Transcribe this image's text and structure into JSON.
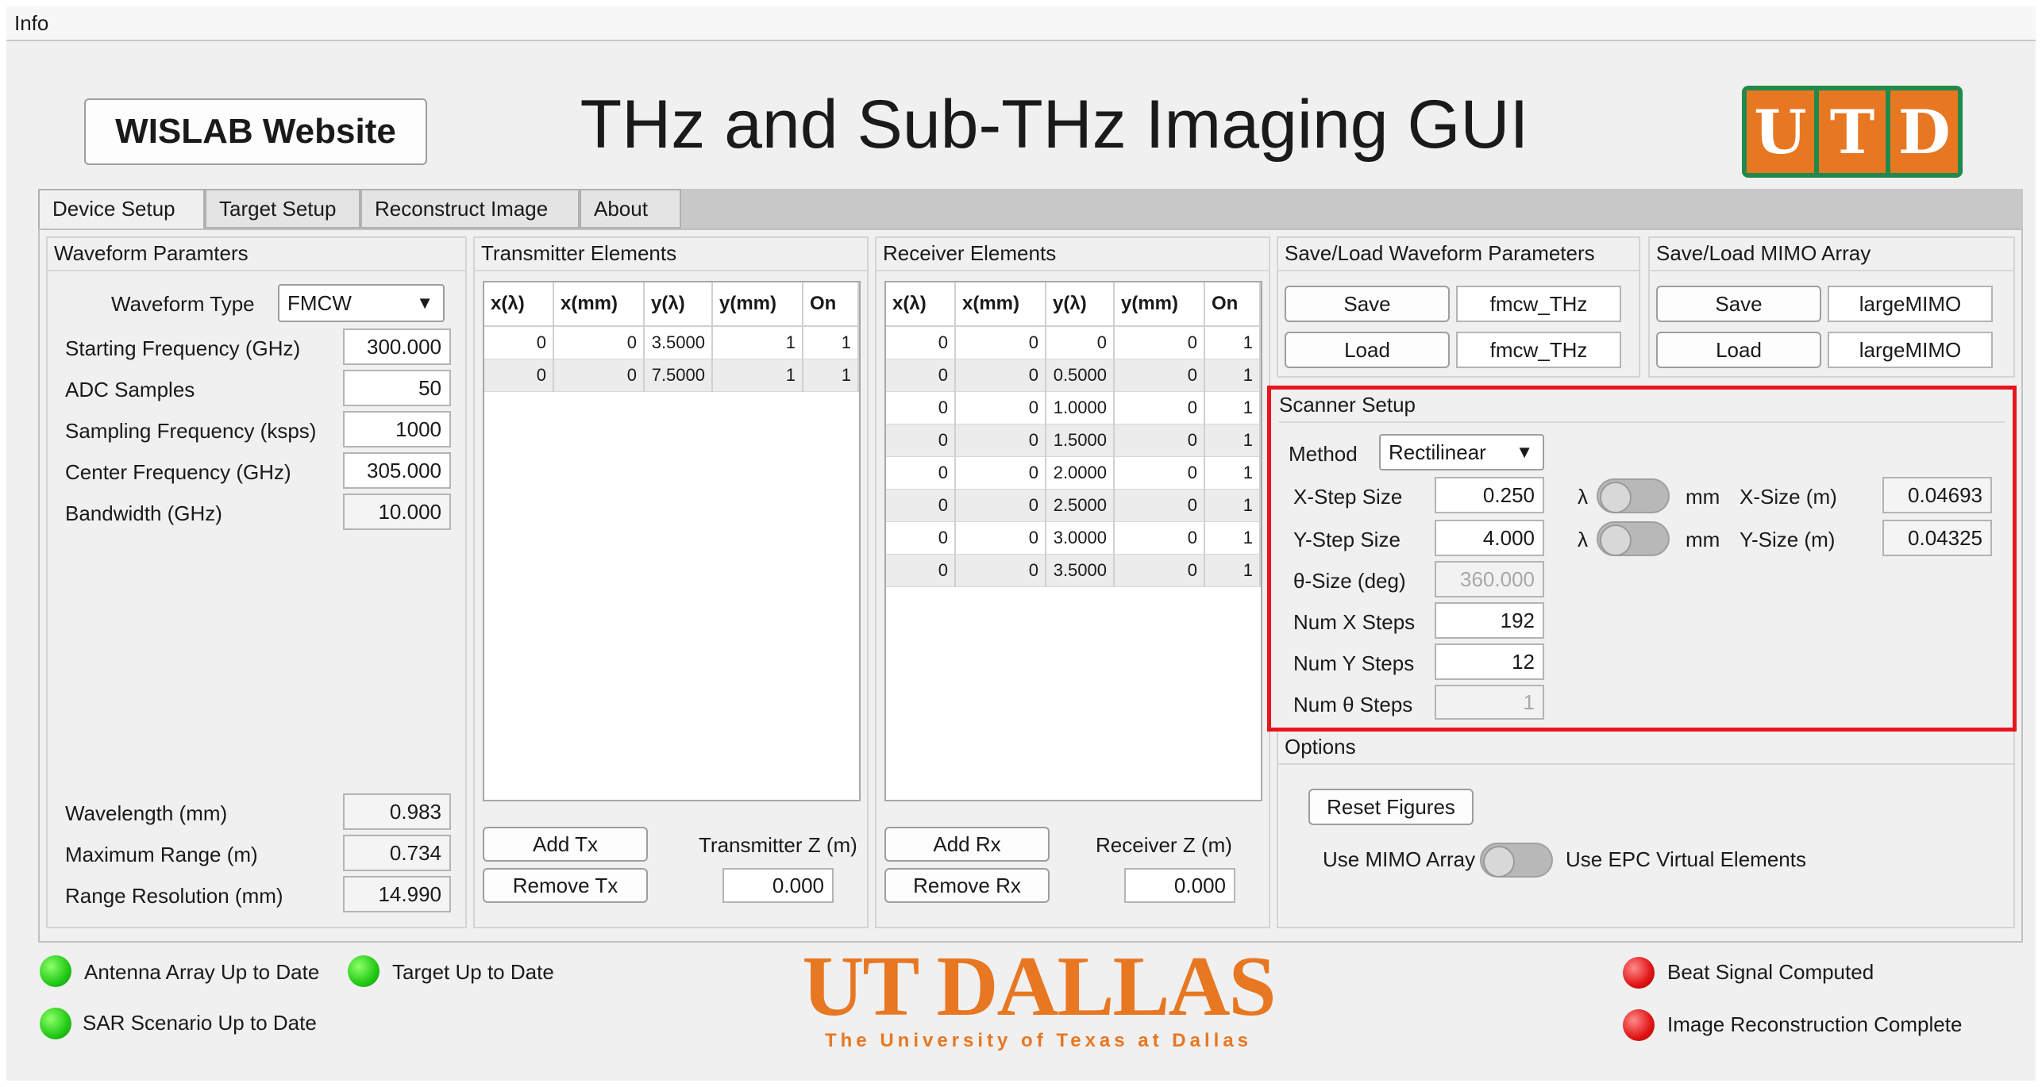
{
  "menu": {
    "info": "Info"
  },
  "header": {
    "website_button": "WISLAB Website",
    "title": "THz and Sub-THz Imaging GUI",
    "logo": {
      "letters": [
        "U",
        "T",
        "D"
      ],
      "color": "#e87722",
      "border": "#1f8a4c"
    }
  },
  "tabs": [
    {
      "label": "Device Setup",
      "active": true
    },
    {
      "label": "Target Setup",
      "active": false
    },
    {
      "label": "Reconstruct Image",
      "active": false
    },
    {
      "label": "About",
      "active": false
    }
  ],
  "waveform": {
    "title": "Waveform Paramters",
    "type_label": "Waveform Type",
    "type_value": "FMCW",
    "fields": [
      {
        "label": "Starting Frequency (GHz)",
        "value": "300.000"
      },
      {
        "label": "ADC Samples",
        "value": "50"
      },
      {
        "label": "Sampling Frequency (ksps)",
        "value": "1000"
      },
      {
        "label": "Center Frequency (GHz)",
        "value": "305.000"
      },
      {
        "label": "Bandwidth (GHz)",
        "value": "10.000"
      }
    ],
    "outputs": [
      {
        "label": "Wavelength (mm)",
        "value": "0.983"
      },
      {
        "label": "Maximum Range (m)",
        "value": "0.734"
      },
      {
        "label": "Range Resolution (mm)",
        "value": "14.990"
      }
    ]
  },
  "transmitter": {
    "title": "Transmitter Elements",
    "columns": [
      "x(λ)",
      "x(mm)",
      "y(λ)",
      "y(mm)",
      "On"
    ],
    "rows": [
      [
        "0",
        "0",
        "3.5000",
        "1",
        "1"
      ],
      [
        "0",
        "0",
        "7.5000",
        "1",
        "1"
      ]
    ],
    "add_label": "Add Tx",
    "remove_label": "Remove Tx",
    "z_label": "Transmitter Z (m)",
    "z_value": "0.000"
  },
  "receiver": {
    "title": "Receiver Elements",
    "columns": [
      "x(λ)",
      "x(mm)",
      "y(λ)",
      "y(mm)",
      "On"
    ],
    "rows": [
      [
        "0",
        "0",
        "0",
        "0",
        "1"
      ],
      [
        "0",
        "0",
        "0.5000",
        "0",
        "1"
      ],
      [
        "0",
        "0",
        "1.0000",
        "0",
        "1"
      ],
      [
        "0",
        "0",
        "1.5000",
        "0",
        "1"
      ],
      [
        "0",
        "0",
        "2.0000",
        "0",
        "1"
      ],
      [
        "0",
        "0",
        "2.5000",
        "0",
        "1"
      ],
      [
        "0",
        "0",
        "3.0000",
        "0",
        "1"
      ],
      [
        "0",
        "0",
        "3.5000",
        "0",
        "1"
      ]
    ],
    "add_label": "Add Rx",
    "remove_label": "Remove Rx",
    "z_label": "Receiver Z (m)",
    "z_value": "0.000"
  },
  "save_waveform": {
    "title": "Save/Load Waveform Parameters",
    "save_label": "Save",
    "load_label": "Load",
    "save_file": "fmcw_THz",
    "load_file": "fmcw_THz"
  },
  "save_mimo": {
    "title": "Save/Load MIMO Array",
    "save_label": "Save",
    "load_label": "Load",
    "save_file": "largeMIMO",
    "load_file": "largeMIMO"
  },
  "scanner": {
    "title": "Scanner Setup",
    "method_label": "Method",
    "method_value": "Rectilinear",
    "x_step_label": "X-Step Size",
    "x_step_value": "0.250",
    "y_step_label": "Y-Step Size",
    "y_step_value": "4.000",
    "lambda_symbol": "λ",
    "mm_label": "mm",
    "x_size_label": "X-Size (m)",
    "x_size_value": "0.04693",
    "y_size_label": "Y-Size (m)",
    "y_size_value": "0.04325",
    "theta_size_label": "θ-Size (deg)",
    "theta_size_value": "360.000",
    "num_x_label": "Num X Steps",
    "num_x_value": "192",
    "num_y_label": "Num Y Steps",
    "num_y_value": "12",
    "num_theta_label": "Num θ Steps",
    "num_theta_value": "1",
    "highlight_color": "#e8141e"
  },
  "options": {
    "title": "Options",
    "reset_label": "Reset Figures",
    "mimo_label": "Use MIMO Array",
    "epc_label": "Use EPC Virtual Elements"
  },
  "status": {
    "antenna": "Antenna Array Up to Date",
    "target": "Target Up to Date",
    "sar": "SAR Scenario Up to Date",
    "beat": "Beat Signal Computed",
    "image": "Image Reconstruction Complete"
  },
  "footer_logo": {
    "name": "UT DALLAS",
    "tagline": "The University of Texas at Dallas",
    "color": "#e87722"
  }
}
